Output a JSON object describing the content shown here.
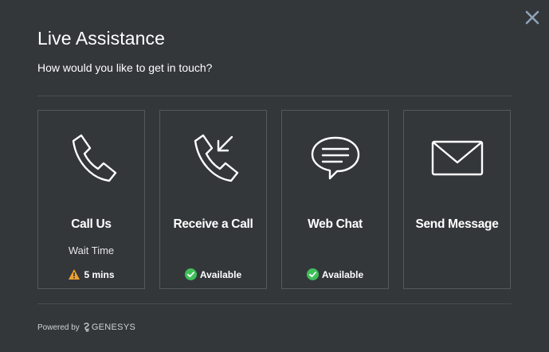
{
  "dialog": {
    "title": "Live Assistance",
    "subtitle": "How would you like to get in touch?",
    "close_icon": "close-icon"
  },
  "options": [
    {
      "label": "Call Us",
      "icon": "phone-icon",
      "wait_label": "Wait Time",
      "status": "5 mins",
      "status_icon": "warning-icon"
    },
    {
      "label": "Receive a Call",
      "icon": "phone-incoming-icon",
      "status": "Available",
      "status_icon": "check-circle-icon"
    },
    {
      "label": "Web Chat",
      "icon": "chat-bubble-icon",
      "status": "Available",
      "status_icon": "check-circle-icon"
    },
    {
      "label": "Send Message",
      "icon": "envelope-icon"
    }
  ],
  "footer": {
    "powered_by": "Powered by",
    "brand": "GENESYS"
  },
  "colors": {
    "background": "#33373a",
    "card_border": "#54595e",
    "available_green": "#3fbf5a",
    "warning_orange": "#f0a030",
    "close_icon": "#8fa3b8"
  }
}
